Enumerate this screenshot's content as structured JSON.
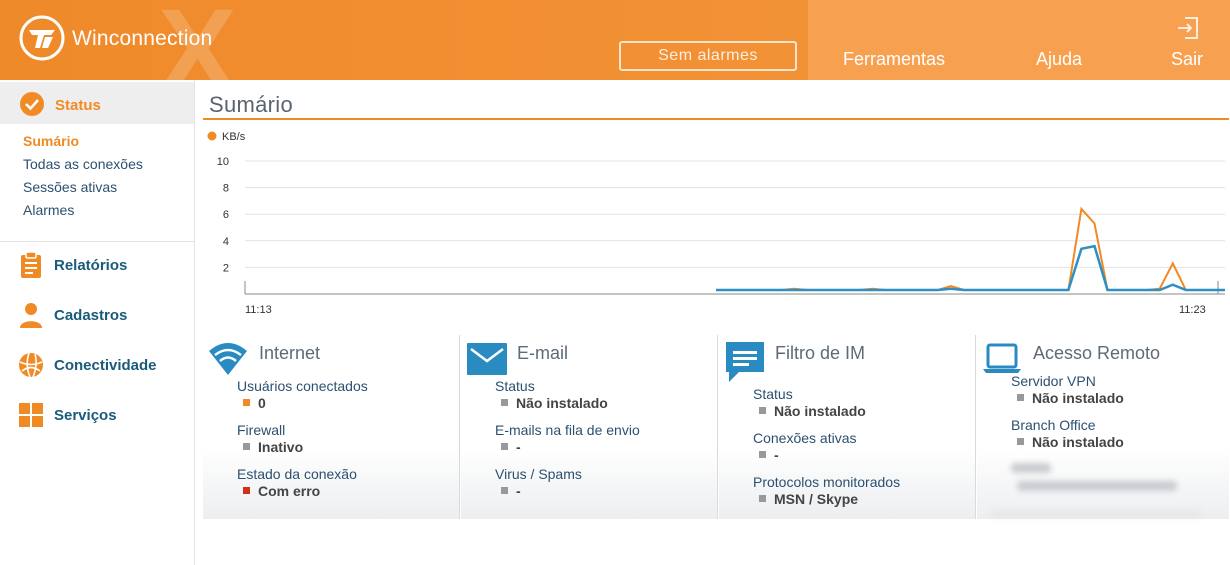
{
  "header": {
    "logo_text": "Winconnection",
    "alarm_button": "Sem alarmes",
    "nav": {
      "tools": "Ferramentas",
      "help": "Ajuda",
      "exit": "Sair"
    }
  },
  "sidebar": {
    "status_label": "Status",
    "sub_items": [
      "Sumário",
      "Todas as conexões",
      "Sessões ativas",
      "Alarmes"
    ],
    "items": [
      "Relatórios",
      "Cadastros",
      "Conectividade",
      "Serviços"
    ]
  },
  "main": {
    "title": "Sumário"
  },
  "chart_data": {
    "type": "line",
    "legend": "KB/s",
    "y_ticks": [
      "10",
      "8",
      "6",
      "4",
      "2"
    ],
    "x_labels": {
      "start": "11:13",
      "end": "11:23"
    },
    "ylim": [
      0,
      10
    ],
    "series": [
      {
        "color": "#f08a24",
        "values": [
          0.3,
          0.3,
          0.3,
          0.3,
          0.3,
          0.3,
          0.4,
          0.3,
          0.3,
          0.3,
          0.3,
          0.3,
          0.4,
          0.3,
          0.3,
          0.3,
          0.3,
          0.3,
          0.6,
          0.3,
          0.3,
          0.3,
          0.3,
          0.3,
          0.3,
          0.3,
          0.3,
          0.3,
          6.4,
          5.3,
          0.3,
          0.3,
          0.3,
          0.3,
          0.4,
          2.3,
          0.3,
          0.3,
          0.3,
          0.3
        ]
      },
      {
        "color": "#2e8fc4",
        "values": [
          0.3,
          0.3,
          0.3,
          0.3,
          0.3,
          0.3,
          0.3,
          0.3,
          0.3,
          0.3,
          0.3,
          0.3,
          0.3,
          0.3,
          0.3,
          0.3,
          0.3,
          0.3,
          0.4,
          0.3,
          0.3,
          0.3,
          0.3,
          0.3,
          0.3,
          0.3,
          0.3,
          0.3,
          3.4,
          3.6,
          0.3,
          0.3,
          0.3,
          0.3,
          0.3,
          0.7,
          0.3,
          0.3,
          0.3,
          0.3
        ]
      }
    ],
    "colors": {
      "grid": "#dfe3e6",
      "axis": "#888888"
    }
  },
  "cards": [
    {
      "title": "Internet",
      "icon": "wifi-icon",
      "rows": [
        {
          "label": "Usuários conectados",
          "value": "0",
          "color": "orange"
        },
        {
          "label": "Firewall",
          "value": "Inativo",
          "color": "gray"
        },
        {
          "label": "Estado da conexão",
          "value": "Com erro",
          "color": "red"
        }
      ]
    },
    {
      "title": "E-mail",
      "icon": "envelope-icon",
      "rows": [
        {
          "label": "Status",
          "value": "Não instalado",
          "color": "gray"
        },
        {
          "label": "E-mails na fila de envio",
          "value": "-",
          "color": "gray"
        },
        {
          "label": "Virus / Spams",
          "value": "-",
          "color": "gray"
        }
      ]
    },
    {
      "title": "Filtro de IM",
      "icon": "chat-icon",
      "rows": [
        {
          "label": "Status",
          "value": "Não instalado",
          "color": "gray"
        },
        {
          "label": "Conexões ativas",
          "value": "-",
          "color": "gray"
        },
        {
          "label": "Protocolos monitorados",
          "value": "MSN / Skype",
          "color": "gray"
        }
      ]
    },
    {
      "title": "Acesso Remoto",
      "icon": "laptop-icon",
      "rows": [
        {
          "label": "Servidor VPN",
          "value": "Não instalado",
          "color": "gray"
        },
        {
          "label": "Branch Office",
          "value": "Não instalado",
          "color": "gray"
        }
      ]
    }
  ],
  "colors": {
    "accent": "#f08a24",
    "nav_blue": "#1a5a7a",
    "chart_orange": "#f08a24",
    "chart_blue": "#2e8fc4",
    "error_red": "#d0311a"
  }
}
